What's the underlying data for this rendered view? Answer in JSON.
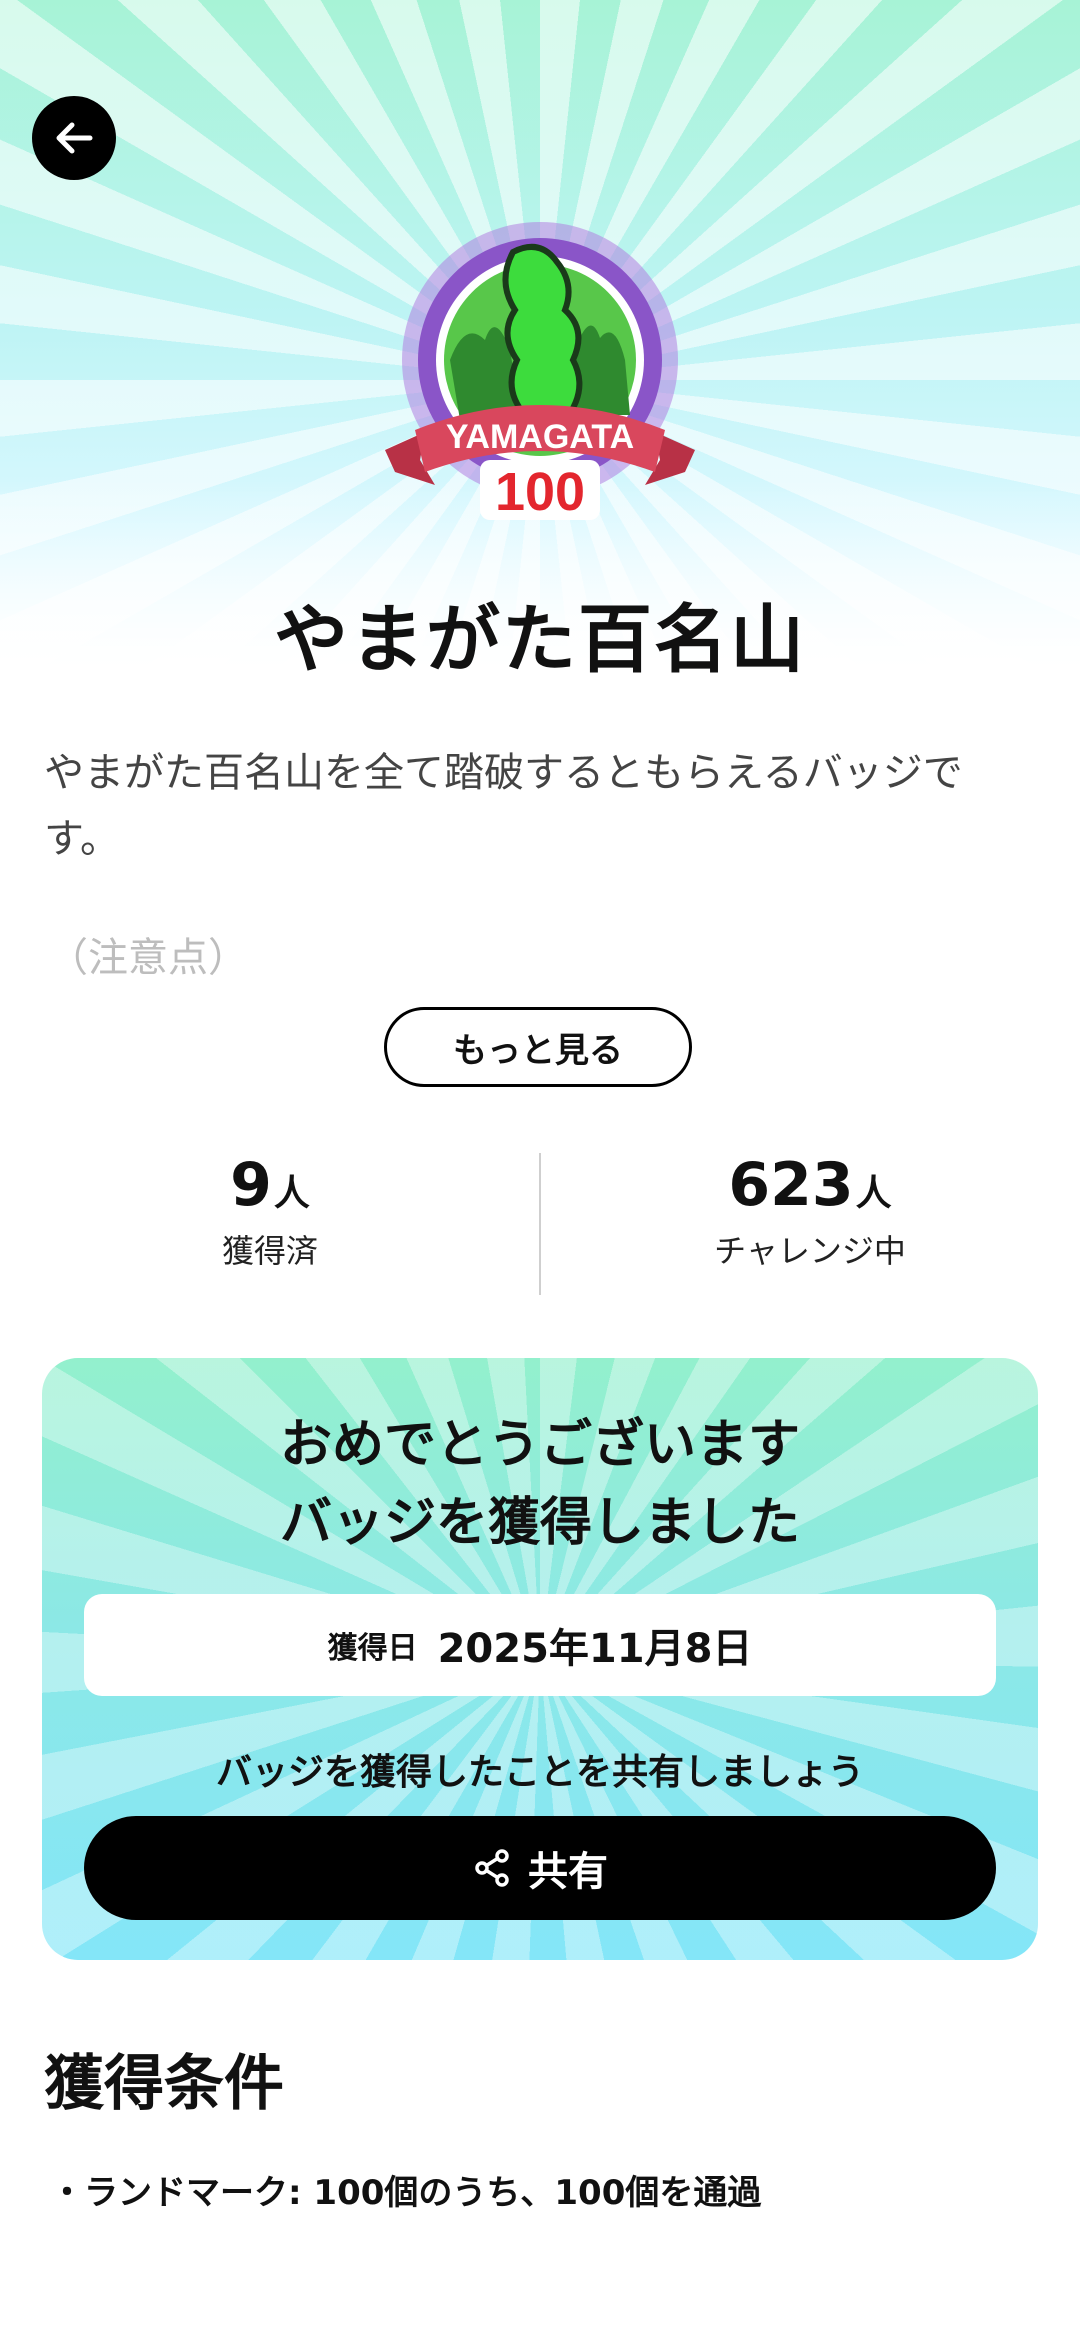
{
  "header": {
    "back_icon": "arrow-left-icon"
  },
  "badge": {
    "banner_text": "YAMAGATA",
    "number_text": "100",
    "colors": {
      "ring": "#8a55c8",
      "green": "#3ddc3d",
      "ribbon": "#d9475d",
      "number": "#e3262e"
    }
  },
  "title": "やまがた百名山",
  "description": "やまがた百名山を全て踏破するともらえるバッジです。",
  "note": "（注意点）",
  "more_button": "もっと見る",
  "stats": {
    "acquired": {
      "value": "9",
      "unit": "人",
      "label": "獲得済"
    },
    "challenging": {
      "value": "623",
      "unit": "人",
      "label": "チャレンジ中"
    }
  },
  "congrats": {
    "line1": "おめでとうございます",
    "line2": "バッジを獲得しました",
    "date_label": "獲得日",
    "date_value": "2025年11月8日",
    "share_message": "バッジを獲得したことを共有しましょう",
    "share_button": "共有",
    "share_icon": "share-icon"
  },
  "conditions": {
    "title": "獲得条件",
    "items": [
      "・ランドマーク: 100個のうち、100個を通過"
    ]
  }
}
